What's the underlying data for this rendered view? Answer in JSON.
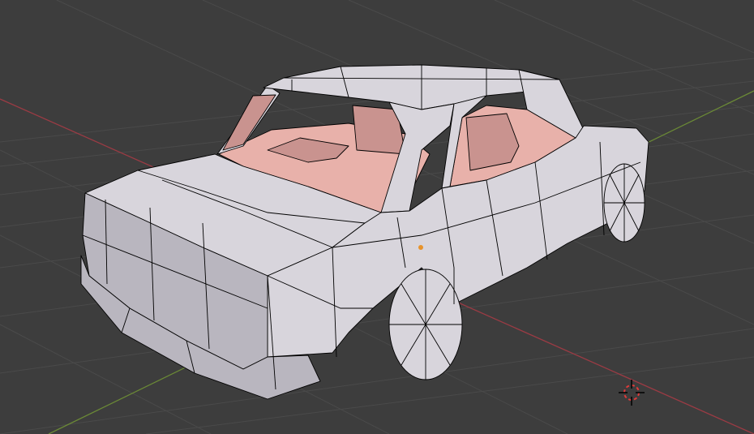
{
  "viewport": {
    "background_color": "#3d3d3d",
    "grid_color": "#4a4a4a",
    "x_axis_color": "#9b3b44",
    "y_axis_color": "#6b8a36"
  },
  "mesh": {
    "body_color": "#d8d5dc",
    "body_shadow_color": "#b9b6bf",
    "interior_color": "#e8b1aa",
    "interior_shadow_color": "#c9938f",
    "wire_color": "#000000",
    "origin_color": "#e8932b"
  },
  "cursor": {
    "icon": "3d-cursor-icon",
    "ring_color": "#e03a3a"
  }
}
